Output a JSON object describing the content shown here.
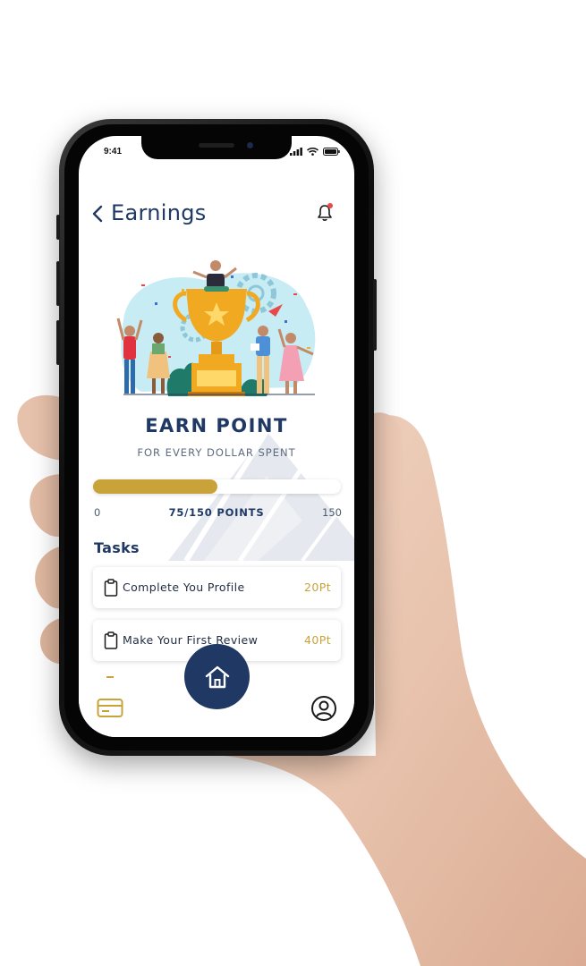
{
  "status_bar": {
    "time": "9:41"
  },
  "header": {
    "title": "Earnings"
  },
  "hero": {
    "title": "EARN POINT",
    "subtitle": "FOR EVERY DOLLAR SPENT"
  },
  "progress": {
    "min_label": "0",
    "max_label": "150",
    "summary": "75/150 POINTS",
    "current": 75,
    "total": 150
  },
  "tasks": {
    "title": "Tasks",
    "items": [
      {
        "label": "Complete You Profile",
        "points": "20Pt"
      },
      {
        "label": "Make Your First Review",
        "points": "40Pt"
      }
    ]
  },
  "tab_bar": {
    "items": [
      "card-icon",
      "home-icon",
      "profile-icon"
    ],
    "active": "home-icon"
  },
  "colors": {
    "primary": "#1f3864",
    "accent": "#c9a23a",
    "alert": "#e8484a"
  }
}
